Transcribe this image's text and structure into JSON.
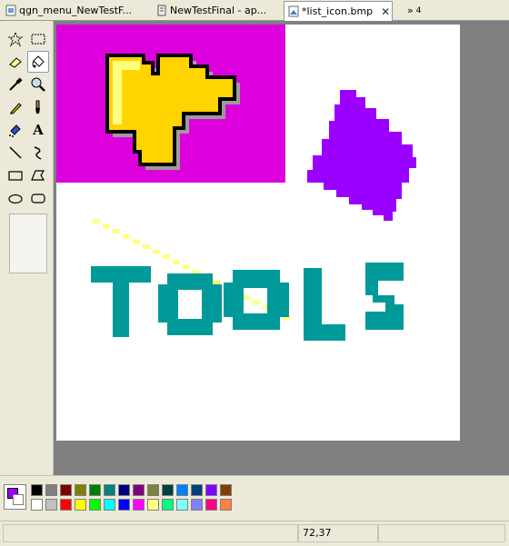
{
  "tabs": [
    {
      "label": "qgn_menu_NewTestF...",
      "icon": "image-file-icon",
      "active": false
    },
    {
      "label": "NewTestFinal - ap...",
      "icon": "file-icon",
      "active": false
    },
    {
      "label": "*list_icon.bmp",
      "icon": "bitmap-file-icon",
      "active": true,
      "close": "✕"
    }
  ],
  "tab_overflow": {
    "label": "»",
    "count": "4"
  },
  "tools": [
    {
      "name": "free-select-tool",
      "selected": false
    },
    {
      "name": "rect-select-tool",
      "selected": false
    },
    {
      "name": "eraser-tool",
      "selected": false
    },
    {
      "name": "fill-tool",
      "selected": true
    },
    {
      "name": "color-picker-tool",
      "selected": false
    },
    {
      "name": "magnifier-tool",
      "selected": false
    },
    {
      "name": "pencil-tool",
      "selected": false
    },
    {
      "name": "brush-tool",
      "selected": false
    },
    {
      "name": "airbrush-tool",
      "selected": false
    },
    {
      "name": "text-tool",
      "selected": false,
      "glyph": "A"
    },
    {
      "name": "line-tool",
      "selected": false
    },
    {
      "name": "curve-tool",
      "selected": false
    },
    {
      "name": "rectangle-tool",
      "selected": false
    },
    {
      "name": "polygon-tool",
      "selected": false
    },
    {
      "name": "ellipse-tool",
      "selected": false
    },
    {
      "name": "rounded-rect-tool",
      "selected": false
    }
  ],
  "canvas": {
    "magenta": "#dd00dd",
    "puzzle_yellow": "#ffd400",
    "purple": "#9900ff",
    "teal": "#009999",
    "dotted_yellow": "#ffff80",
    "text": "TOOLS"
  },
  "colors": {
    "foreground": "#9900ff",
    "background": "#ffffff",
    "row1": [
      "#000000",
      "#808080",
      "#800000",
      "#808000",
      "#008000",
      "#008080",
      "#000080",
      "#800080",
      "#808040",
      "#004040",
      "#0080ff",
      "#004080",
      "#8000ff",
      "#804000"
    ],
    "row2": [
      "#ffffff",
      "#c0c0c0",
      "#ff0000",
      "#ffff00",
      "#00ff00",
      "#00ffff",
      "#0000ff",
      "#ff00ff",
      "#ffff80",
      "#00ff80",
      "#80ffff",
      "#8080ff",
      "#ff0080",
      "#ff8040"
    ]
  },
  "status": {
    "left": "",
    "coords": "72,37",
    "right": ""
  }
}
